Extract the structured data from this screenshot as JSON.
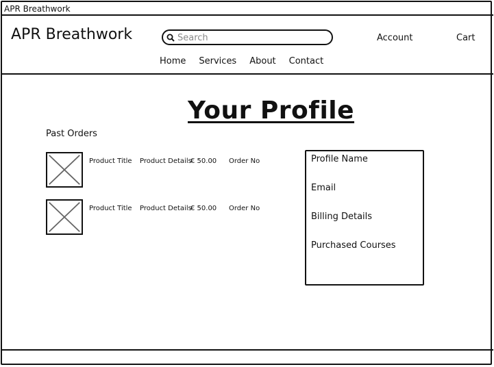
{
  "window": {
    "title": "APR Breathwork"
  },
  "header": {
    "brand": "APR Breathwork",
    "search": {
      "placeholder": "Search",
      "icon": "search-icon"
    },
    "account_label": "Account",
    "cart_label": "Cart"
  },
  "nav": {
    "items": [
      {
        "label": "Home"
      },
      {
        "label": "Services"
      },
      {
        "label": "About"
      },
      {
        "label": "Contact"
      }
    ]
  },
  "main": {
    "page_title": "Your Profile",
    "past_orders": {
      "title": "Past Orders",
      "rows": [
        {
          "product_title": "Product Title",
          "product_details": "Product Details",
          "price": "€ 50.00",
          "order_no": "Order No"
        },
        {
          "product_title": "Product Title",
          "product_details": "Product Details",
          "price": "€ 50.00",
          "order_no": "Order No"
        }
      ]
    },
    "profile": {
      "fields": [
        "Profile Name",
        "Email",
        "Billing Details",
        "Purchased Courses"
      ]
    }
  }
}
